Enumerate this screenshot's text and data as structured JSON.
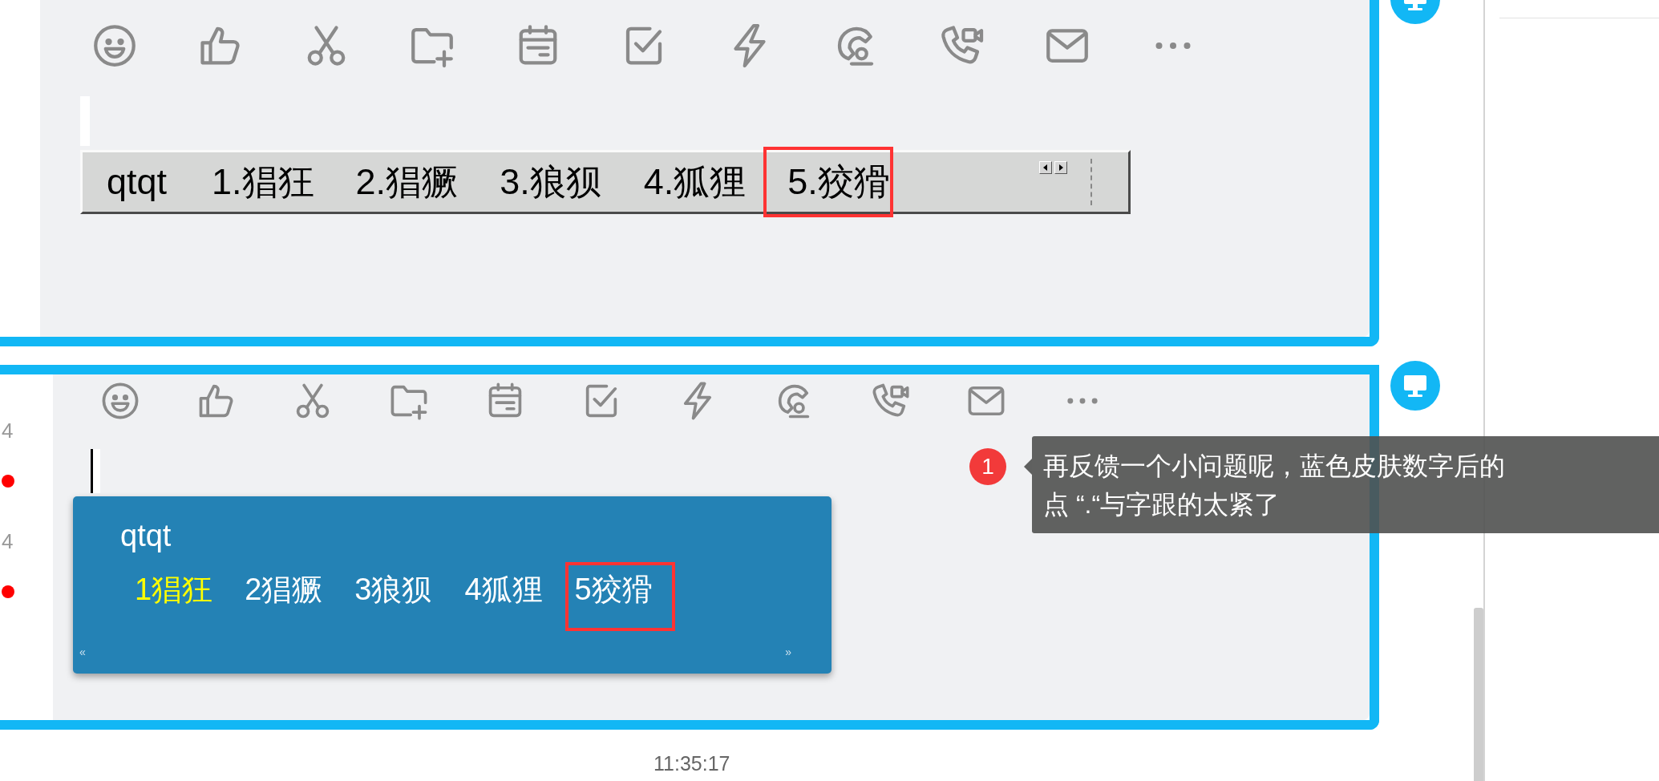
{
  "panels": [
    {
      "candidate_bar": {
        "input": "qtqt",
        "candidates": [
          {
            "text": "1.猖狂",
            "selected": false,
            "highlighted": false
          },
          {
            "text": "2.猖獗",
            "selected": false,
            "highlighted": false
          },
          {
            "text": "3.狼狈",
            "selected": false,
            "highlighted": false
          },
          {
            "text": "4.狐狸",
            "selected": false,
            "highlighted": false
          },
          {
            "text": "5.狡猾",
            "selected": false,
            "highlighted": true
          }
        ]
      }
    },
    {
      "side_items": [
        {
          "text": "4",
          "unread": true
        },
        {
          "text": "4",
          "unread": true
        }
      ],
      "candidate_bar": {
        "input": "qtqt",
        "prev": "«",
        "next": "»",
        "candidates": [
          {
            "text": "1猖狂",
            "selected": true,
            "highlighted": false
          },
          {
            "text": "2猖獗",
            "selected": false,
            "highlighted": false
          },
          {
            "text": "3狼狈",
            "selected": false,
            "highlighted": false
          },
          {
            "text": "4狐狸",
            "selected": false,
            "highlighted": false
          },
          {
            "text": "5狡猾",
            "selected": false,
            "highlighted": true
          }
        ]
      }
    }
  ],
  "timestamp": "11:35:17",
  "comment": {
    "number": "1",
    "lines": [
      "再反馈一个小问题呢，蓝色皮肤数字后的",
      "点 “.“与字跟的太紧了"
    ]
  }
}
